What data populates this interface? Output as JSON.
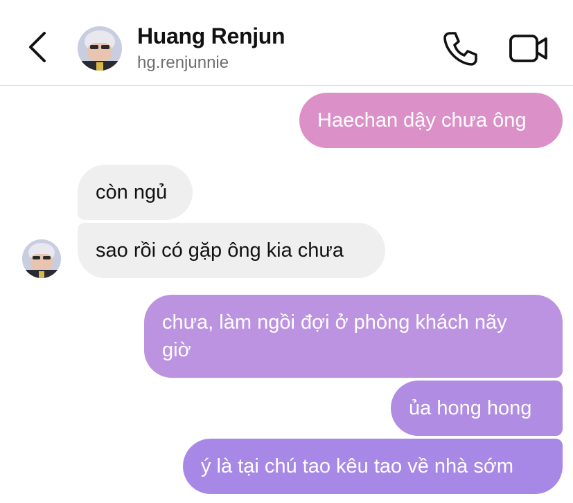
{
  "header": {
    "name": "Huang Renjun",
    "handle": "hg.renjunnie",
    "icons": {
      "back": "chevron-left-icon",
      "call": "phone-icon",
      "video": "video-camera-icon"
    }
  },
  "colors": {
    "outgoing_gradient_top": "#df8fc4",
    "outgoing_gradient_bottom": "#a585e4",
    "incoming": "#efefef",
    "divider": "#dcdcdc"
  },
  "messages": [
    {
      "sender": "me",
      "text": "Haechan dậy chưa ông"
    },
    {
      "sender": "them",
      "text": "còn ngủ"
    },
    {
      "sender": "them",
      "text": "sao rồi có gặp ông kia chưa"
    },
    {
      "sender": "me",
      "text": "chưa, làm ngồi đợi ở phòng khách nãy giờ"
    },
    {
      "sender": "me",
      "text": "ủa hong hong"
    },
    {
      "sender": "me",
      "text": "ý là tại chú tao kêu tao về nhà sớm"
    }
  ]
}
